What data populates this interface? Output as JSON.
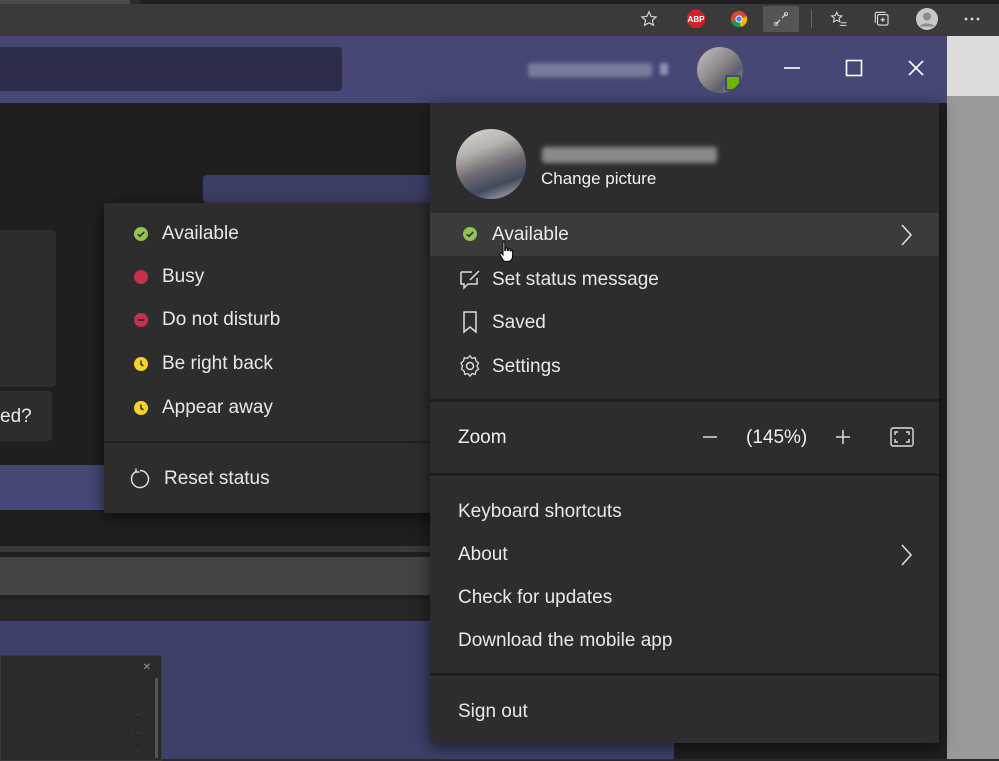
{
  "browser": {
    "icons": [
      "favorites-star-icon",
      "adblock-plus-icon",
      "chrome-icon",
      "extension-link-icon",
      "favorites-list-icon",
      "collections-icon",
      "profile-avatar-icon",
      "more-options-icon"
    ],
    "abp_label": "ABP"
  },
  "titlebar": {
    "window_buttons": [
      "minimize-icon",
      "maximize-icon",
      "close-icon"
    ],
    "presence_color": "#6bb700"
  },
  "background": {
    "partial_message": "ed?"
  },
  "status_menu": {
    "items": [
      {
        "label": "Available",
        "color": "#92c353",
        "icon": "check"
      },
      {
        "label": "Busy",
        "color": "#c4314b",
        "icon": "dot"
      },
      {
        "label": "Do not disturb",
        "color": "#c4314b",
        "icon": "minus"
      },
      {
        "label": "Be right back",
        "color": "#f8d22a",
        "icon": "clock"
      },
      {
        "label": "Appear away",
        "color": "#f8d22a",
        "icon": "clock"
      }
    ],
    "reset_label": "Reset status"
  },
  "profile_menu": {
    "change_picture": "Change picture",
    "status_label": "Available",
    "set_status_message": "Set status message",
    "saved": "Saved",
    "settings": "Settings",
    "zoom": {
      "label": "Zoom",
      "value": "(145%)"
    },
    "keyboard_shortcuts": "Keyboard shortcuts",
    "about": "About",
    "check_updates": "Check for updates",
    "download_mobile": "Download the mobile app",
    "sign_out": "Sign out"
  },
  "colors": {
    "teams_purple": "#464775",
    "menu_bg": "#2d2d2d",
    "available_green": "#92c353"
  }
}
